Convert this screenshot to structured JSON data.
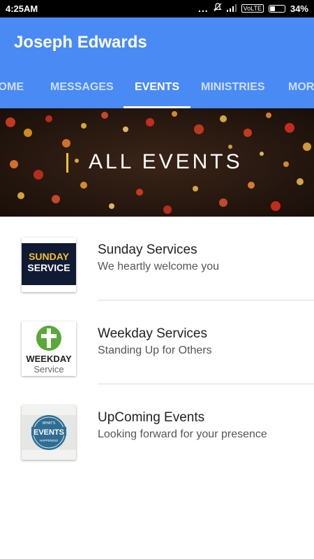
{
  "status_bar": {
    "time": "4:25AM",
    "dots": "...",
    "network": "VoLTE",
    "battery_text": "34%",
    "battery_level": 0.34
  },
  "app_bar": {
    "title": "Joseph Edwards",
    "color": "#4a8af4"
  },
  "tabs": [
    {
      "label": "WELCOME",
      "visible_text": "COME"
    },
    {
      "label": "MESSAGES"
    },
    {
      "label": "EVENTS",
      "active": true
    },
    {
      "label": "MINISTRIES"
    },
    {
      "label": "MORE",
      "visible_text": "MOR"
    }
  ],
  "hero": {
    "heading": "ALL EVENTS",
    "accent_color": "#f2c230"
  },
  "events": [
    {
      "title": "Sunday Services",
      "subtitle": "We heartly welcome you",
      "thumb_text": [
        "SUNDAY",
        "SERVICE"
      ]
    },
    {
      "title": "Weekday Services",
      "subtitle": "Standing Up for Others",
      "thumb_text": [
        "WEEKDAY",
        "Service"
      ]
    },
    {
      "title": "UpComing Events",
      "subtitle": "Looking forward for your presence",
      "thumb_text": [
        "WHAT'S",
        "EVENTS",
        "HAPPENING"
      ]
    }
  ]
}
